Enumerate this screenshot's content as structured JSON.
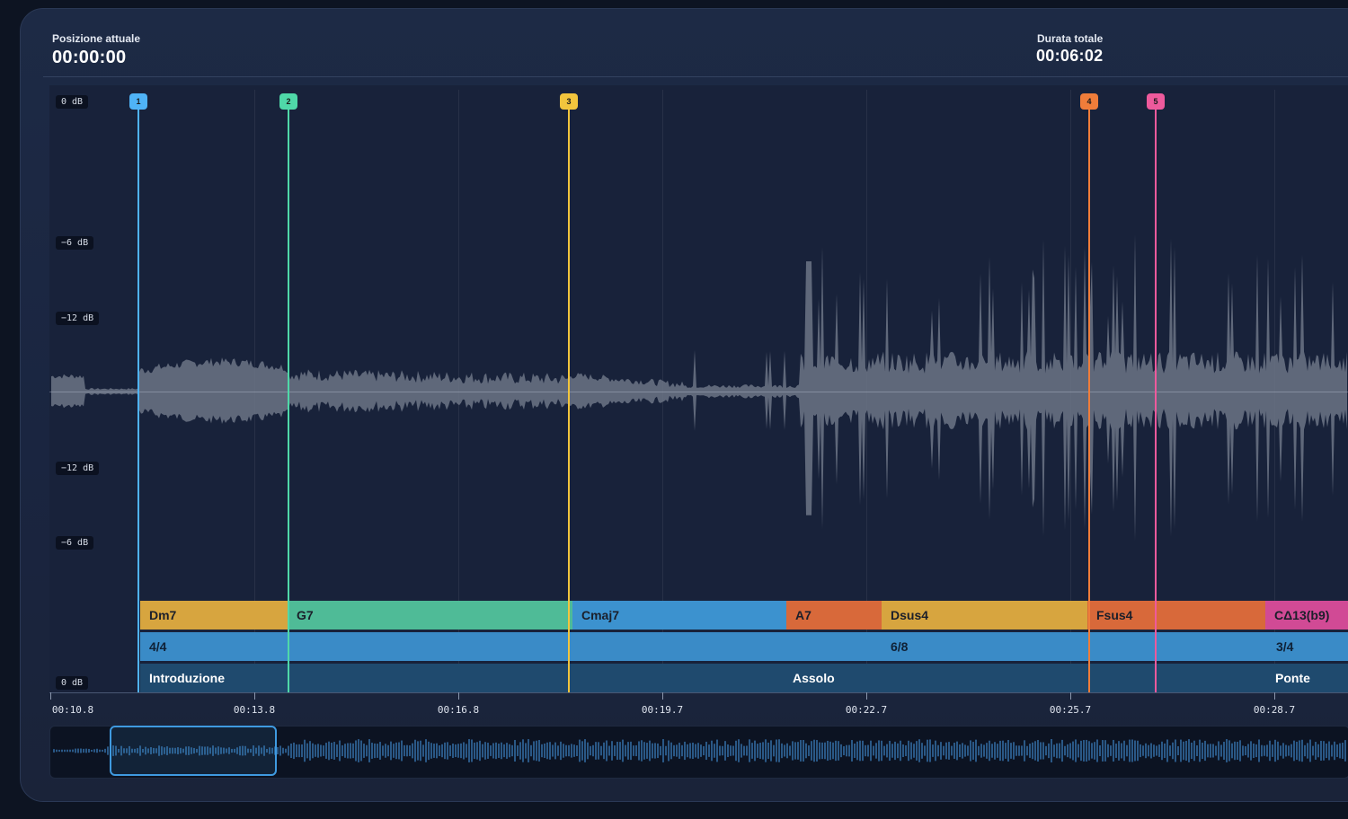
{
  "header": {
    "position_label": "Posizione attuale",
    "position_value": "00:00:00",
    "duration_label": "Durata totale",
    "duration_value": "00:06:02"
  },
  "db_labels": [
    "0 dB",
    "−6 dB",
    "−12 dB",
    "−12 dB",
    "−6 dB",
    "0 dB"
  ],
  "markers": [
    {
      "label": "1",
      "color": "#4fb3f6"
    },
    {
      "label": "2",
      "color": "#4fd8a8"
    },
    {
      "label": "3",
      "color": "#f2c53d"
    },
    {
      "label": "4",
      "color": "#ef7d3a"
    },
    {
      "label": "5",
      "color": "#ee5a9c"
    }
  ],
  "chords": [
    {
      "name": "Dm7",
      "color": "#d7a53f"
    },
    {
      "name": "G7",
      "color": "#4fbb97"
    },
    {
      "name": "Cmaj7",
      "color": "#3c92cf"
    },
    {
      "name": "A7",
      "color": "#d8693a"
    },
    {
      "name": "Dsus4",
      "color": "#d7a53f"
    },
    {
      "name": "Fsus4",
      "color": "#d8693a"
    },
    {
      "name": "CΔ13(b9)",
      "color": "#d14a95"
    }
  ],
  "signatures": [
    {
      "name": "4/4"
    },
    {
      "name": "6/8"
    },
    {
      "name": "3/4"
    }
  ],
  "sections": [
    {
      "name": "Introduzione"
    },
    {
      "name": "Assolo"
    },
    {
      "name": "Ponte"
    }
  ],
  "timeline": [
    "00:10.8",
    "00:13.8",
    "00:16.8",
    "00:19.7",
    "00:22.7",
    "00:25.7",
    "00:28.7"
  ]
}
